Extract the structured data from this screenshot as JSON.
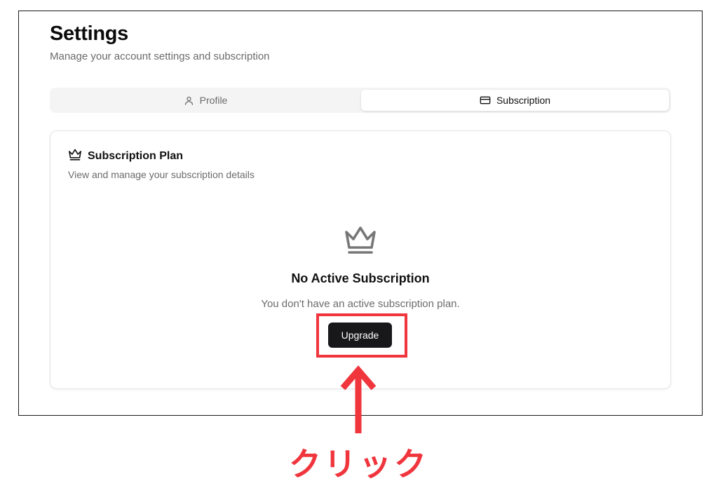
{
  "header": {
    "title": "Settings",
    "subtitle": "Manage your account settings and subscription"
  },
  "tabs": [
    {
      "label": "Profile",
      "icon": "user-icon",
      "active": false
    },
    {
      "label": "Subscription",
      "icon": "credit-card-icon",
      "active": true
    }
  ],
  "card": {
    "icon": "crown-icon",
    "title": "Subscription Plan",
    "description": "View and manage your subscription details"
  },
  "empty_state": {
    "icon": "crown-icon",
    "title": "No Active Subscription",
    "message": "You don't have an active subscription plan.",
    "button_label": "Upgrade"
  },
  "annotation": {
    "label": "クリック",
    "color": "#f0353d"
  },
  "colors": {
    "primary_button": "#18181b",
    "muted_text": "#6b6b6b",
    "tab_track": "#f4f4f5",
    "annotation_red": "#f0353d"
  }
}
